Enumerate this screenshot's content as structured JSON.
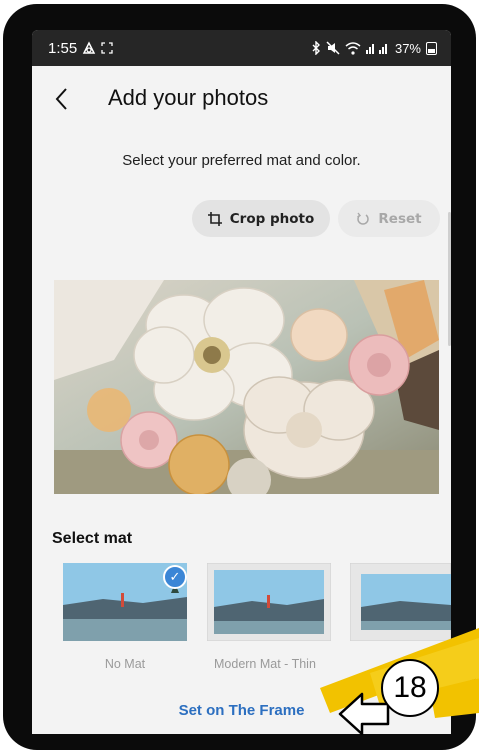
{
  "status_bar": {
    "time": "1:55",
    "battery": "37%"
  },
  "header": {
    "title": "Add your photos"
  },
  "subtitle": "Select your preferred mat and color.",
  "actions": {
    "crop_label": "Crop photo",
    "reset_label": "Reset"
  },
  "select_mat": {
    "title": "Select mat",
    "options": [
      {
        "label": "No Mat",
        "selected": true
      },
      {
        "label": "Modern Mat - Thin",
        "selected": false
      },
      {
        "label": "",
        "selected": false
      }
    ]
  },
  "primary_action": "Set on The Frame",
  "annotation": {
    "step": "18"
  },
  "colors": {
    "accent": "#2c6fc0",
    "check": "#3b86d6",
    "highlight": "#f2c200"
  }
}
